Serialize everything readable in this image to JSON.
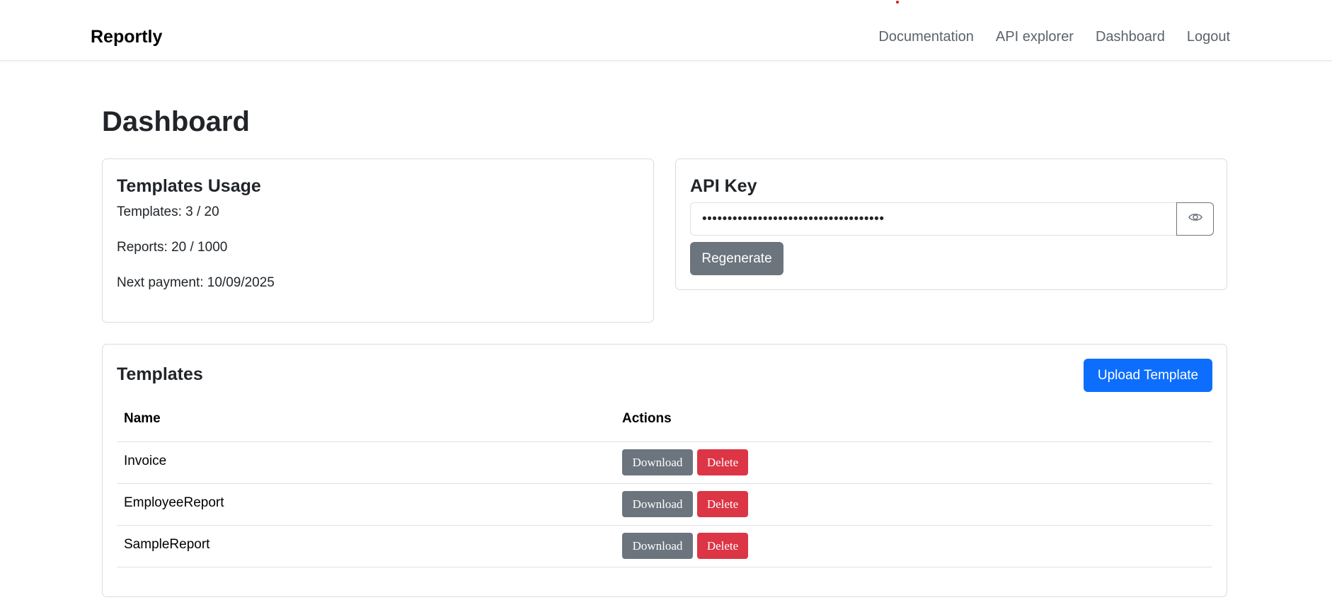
{
  "brand": "Reportly",
  "nav": {
    "links": [
      "Documentation",
      "API explorer",
      "Dashboard",
      "Logout"
    ]
  },
  "page": {
    "title": "Dashboard"
  },
  "usage": {
    "title": "Templates Usage",
    "templates": "Templates: 3 / 20",
    "reports": "Reports: 20 / 1000",
    "next_payment": "Next payment: 10/09/2025"
  },
  "api": {
    "title": "API Key",
    "masked_value": "••••••••••••••••••••••••••••••••••••",
    "toggle_icon": "eye-icon",
    "regenerate_label": "Regenerate"
  },
  "templates": {
    "title": "Templates",
    "upload_label": "Upload Template",
    "columns": [
      "Name",
      "Actions"
    ],
    "rows": [
      {
        "name": "Invoice",
        "download": "Download",
        "delete": "Delete"
      },
      {
        "name": "EmployeeReport",
        "download": "Download",
        "delete": "Delete"
      },
      {
        "name": "SampleReport",
        "download": "Download",
        "delete": "Delete"
      }
    ]
  },
  "colors": {
    "primary": "#0d6efd",
    "secondary": "#6c757d",
    "danger": "#dc3545"
  }
}
